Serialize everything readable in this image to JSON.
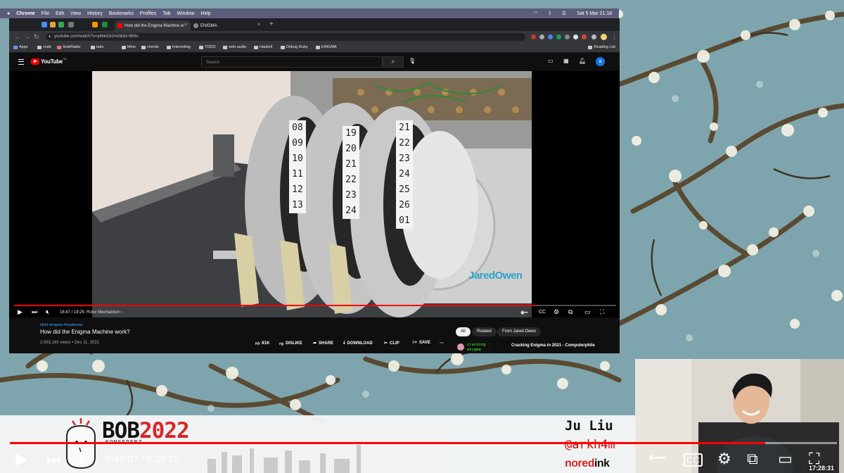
{
  "mac_menubar": {
    "app": "Chrome",
    "items": [
      "File",
      "Edit",
      "View",
      "History",
      "Bookmarks",
      "Profiles",
      "Tab",
      "Window",
      "Help"
    ],
    "clock": "Sat 5 Mar  21:18"
  },
  "browser": {
    "tabs": [
      {
        "label": "How did the Enigma Machine w",
        "active": true
      },
      {
        "label": "ENIGMA",
        "active": false
      }
    ],
    "url": "youtube.com/watch?v=ybkkiGtJmkM&t=906s",
    "bookmarks": [
      "Apps",
      "code",
      "SoleRader",
      "tabs",
      "Mine",
      "chords",
      "Interesting",
      "TODO",
      "web audio",
      "Haskell",
      "Debug Ruby",
      "ENIGMA"
    ],
    "reading_list": "Reading List"
  },
  "youtube": {
    "logo_text": "YouTube",
    "logo_cc": "GB",
    "search_placeholder": "Search",
    "avatar_letter": "a",
    "player": {
      "time": "16:47 / 19:25",
      "chapter": "Rotor Mechanism",
      "watermark": "JaredOwen",
      "progress": 0.864,
      "rotor_numbers_left": [
        "08",
        "09",
        "10",
        "11",
        "12",
        "13"
      ],
      "rotor_numbers_mid": [
        "19",
        "20",
        "21",
        "22",
        "23",
        "24"
      ],
      "rotor_numbers_right": [
        "21",
        "22",
        "23",
        "24",
        "25",
        "26",
        "01"
      ]
    },
    "video": {
      "tags": "#b3d #enigma #howitworks",
      "title": "How did the Enigma Machine work?",
      "meta": "2,693,160 views • Dec 11, 2021"
    },
    "actions": [
      "81K",
      "DISLIKE",
      "SHARE",
      "DOWNLOAD",
      "CLIP",
      "SAVE"
    ],
    "chips": [
      "All",
      "Related",
      "From Jared Owen"
    ],
    "recommendation": {
      "thumb_text": "cracking enigma",
      "title": "Cracking Enigma in 2021 - Computerphile"
    }
  },
  "conference": {
    "name": "BOB",
    "year": "2022",
    "subtitle": "KONFERENZ",
    "speaker": "Ju Liu",
    "handle": "@arkh4m",
    "company_no": "no",
    "company_red": "red",
    "company_ink": "ink"
  },
  "outer_player": {
    "time": "8:46:07 / 9:36:20",
    "progress": 0.913,
    "clock": "17:28:31"
  },
  "colors": {
    "accent_red": "#ff0000",
    "youtube_bg": "#0f0f0f",
    "bob_red": "#d62828",
    "link_blue": "#3ea6ff"
  }
}
